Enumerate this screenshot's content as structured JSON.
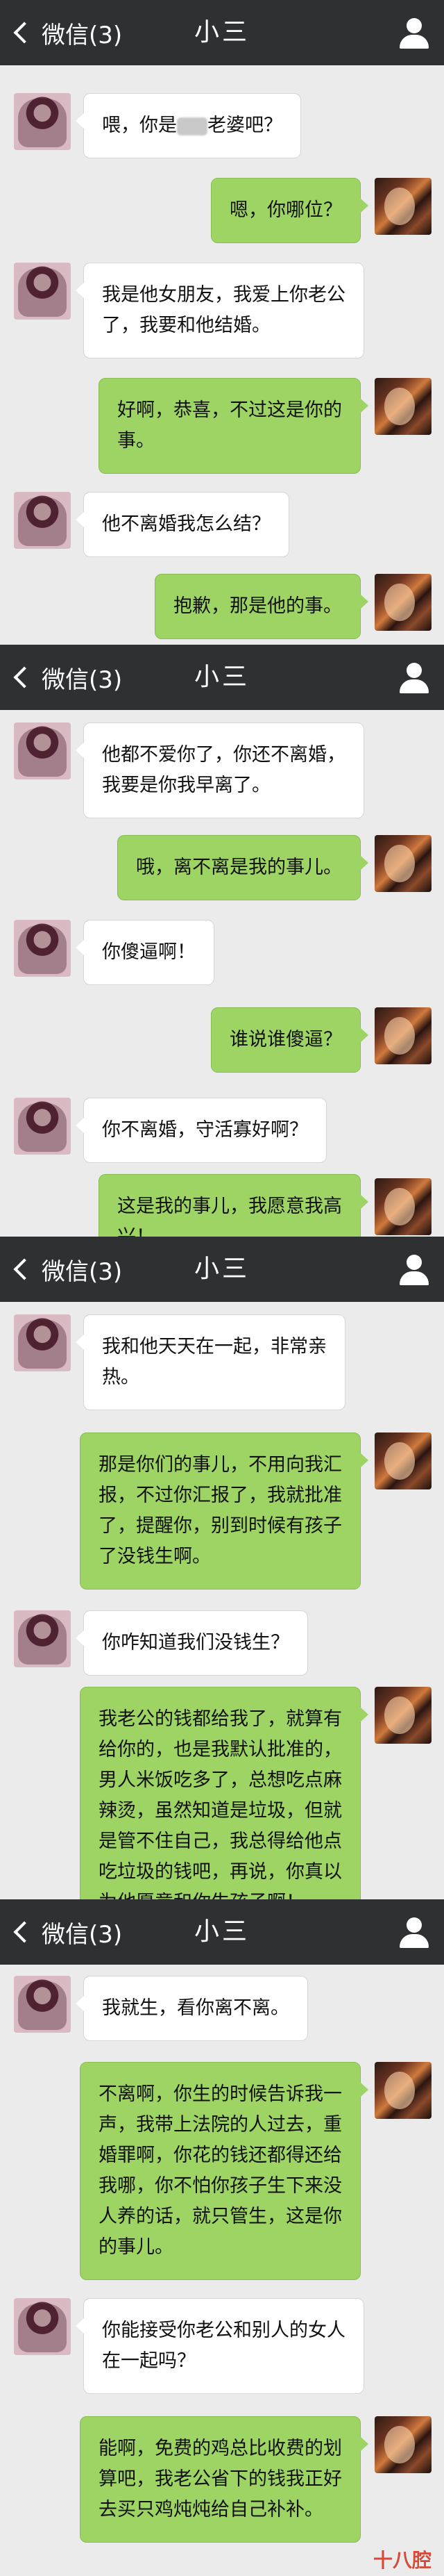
{
  "nav": {
    "back_label": "微信(3)",
    "title": "小三"
  },
  "screens": [
    {
      "messages": [
        {
          "side": "in",
          "text": "喂，你是",
          "text_after": "老婆吧？",
          "blurred": true
        },
        {
          "side": "out",
          "text": "嗯，你哪位？"
        },
        {
          "side": "in",
          "text": "我是他女朋友，我爱上你老公\n了，我要和他结婚。"
        },
        {
          "side": "out",
          "text": "好啊，恭喜，不过这是你的\n事。"
        },
        {
          "side": "in",
          "text": "他不离婚我怎么结？"
        },
        {
          "side": "out",
          "text": "抱歉，那是他的事。"
        }
      ]
    },
    {
      "messages": [
        {
          "side": "in",
          "text": "他都不爱你了，你还不离婚，\n我要是你我早离了。"
        },
        {
          "side": "out",
          "text": "哦，离不离是我的事儿。"
        },
        {
          "side": "in",
          "text": "你傻逼啊！"
        },
        {
          "side": "out",
          "text": "谁说谁傻逼？"
        },
        {
          "side": "in",
          "text": "你不离婚，守活寡好啊？"
        },
        {
          "side": "out",
          "text": "这是我的事儿，我愿意我高\n兴！"
        }
      ]
    },
    {
      "messages": [
        {
          "side": "in",
          "text": "我和他天天在一起，非常亲\n热。"
        },
        {
          "side": "out",
          "text": "那是你们的事儿，不用向我汇\n报，不过你汇报了，我就批准\n了，提醒你，别到时候有孩子\n了没钱生啊。"
        },
        {
          "side": "in",
          "text": "你咋知道我们没钱生？"
        },
        {
          "side": "out",
          "text": "我老公的钱都给我了，就算有\n给你的，也是我默认批准的，\n男人米饭吃多了，总想吃点麻\n辣烫，虽然知道是垃圾，但就\n是管不住自己，我总得给他点\n吃垃圾的钱吧，再说，你真以\n为他愿意和你生孩子啊！"
        }
      ]
    },
    {
      "messages": [
        {
          "side": "in",
          "text": "我就生，看你离不离。"
        },
        {
          "side": "out",
          "text": "不离啊，你生的时候告诉我一\n声，我带上法院的人过去，重\n婚罪啊，你花的钱还都得还给\n我哪，你不怕你孩子生下来没\n人养的话，就只管生，这是你\n的事儿。"
        },
        {
          "side": "in",
          "text": "你能接受你老公和别人的女人\n在一起吗？"
        },
        {
          "side": "out",
          "text": "能啊，免费的鸡总比收费的划\n算吧，我老公省下的钱我正好\n去买只鸡炖炖给自己补补。"
        }
      ]
    }
  ],
  "watermark": "十八腔"
}
